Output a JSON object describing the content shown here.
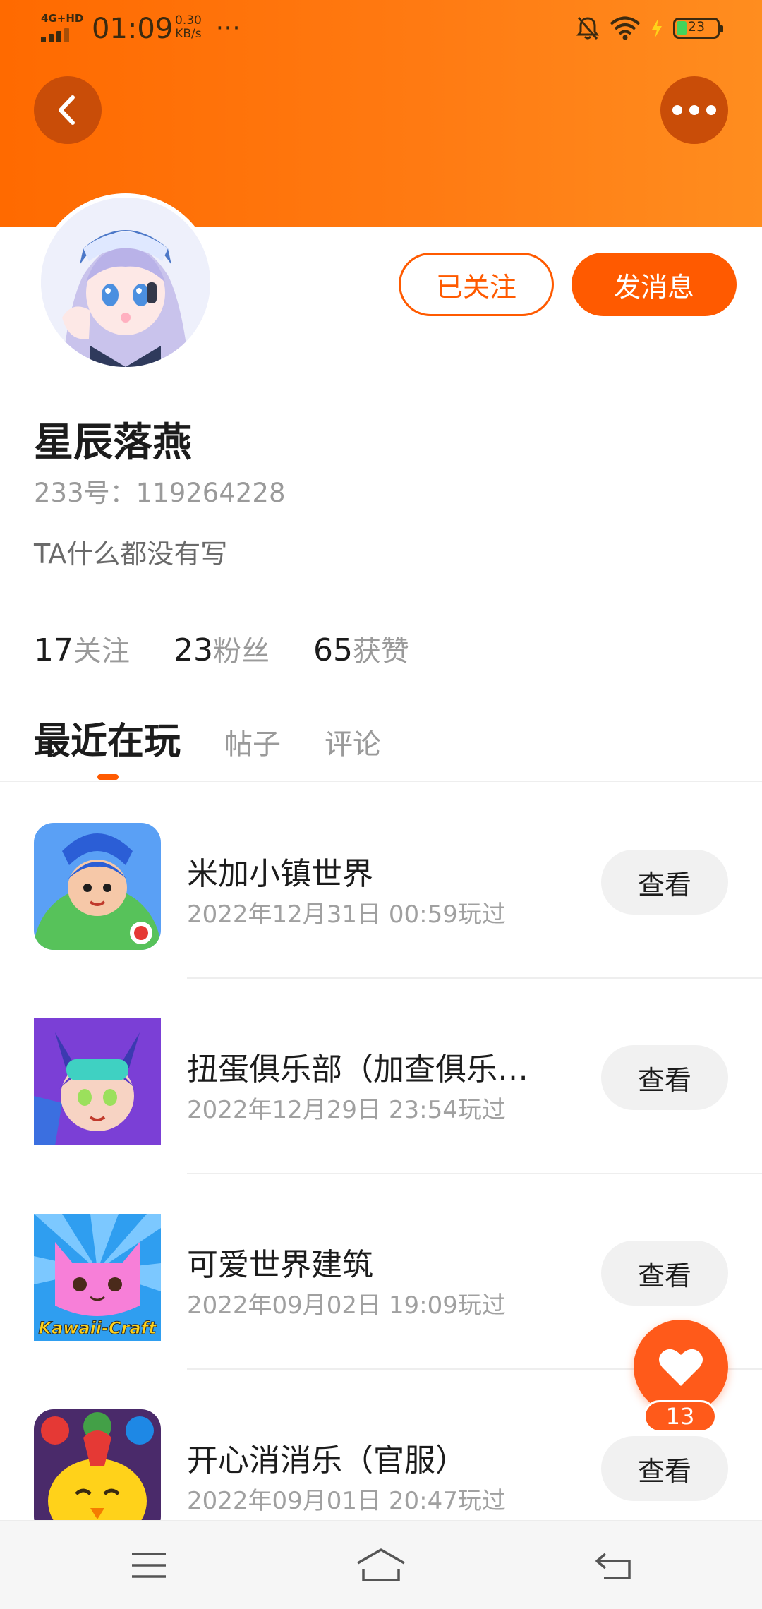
{
  "status_bar": {
    "network": "4G+HD",
    "time": "01:09",
    "speed_value": "0.30",
    "speed_unit": "KB/s",
    "battery": "23",
    "icons": [
      "signal-icon",
      "bell-off-icon",
      "wifi-icon",
      "charging-icon",
      "battery-icon"
    ]
  },
  "header": {
    "back_icon": "chevron-left-icon",
    "more_icon": "more-horizontal-icon",
    "background": "#ff7a12"
  },
  "profile": {
    "name": "星辰落燕",
    "uid": "233号：119264228",
    "bio": "TA什么都没有写",
    "follow_label": "已关注",
    "message_label": "发消息",
    "stats": [
      {
        "value": "17",
        "label": "关注"
      },
      {
        "value": "23",
        "label": "粉丝"
      },
      {
        "value": "65",
        "label": "获赞"
      }
    ]
  },
  "tabs": [
    {
      "label": "最近在玩",
      "active": true
    },
    {
      "label": "帖子",
      "active": false
    },
    {
      "label": "评论",
      "active": false
    }
  ],
  "games": [
    {
      "title": "米加小镇世界",
      "time": "2022年12月31日 00:59玩过",
      "button": "查看"
    },
    {
      "title": "扭蛋俱乐部（加查俱乐…",
      "time": "2022年12月29日 23:54玩过",
      "button": "查看"
    },
    {
      "title": "可爱世界建筑",
      "time": "2022年09月02日 19:09玩过",
      "button": "查看",
      "icon_text": "Kawaii-Craft"
    },
    {
      "title": "开心消消乐（官服）",
      "time": "2022年09月01日 20:47玩过",
      "button": "查看"
    }
  ],
  "like_fab": {
    "count": "13",
    "icon": "heart-icon"
  },
  "navbar": {
    "icons": [
      "menu-icon",
      "home-icon",
      "back-nav-icon"
    ]
  },
  "colors": {
    "accent": "#ff5a00",
    "text": "#1c1c1c",
    "muted": "#9a9a9a"
  }
}
